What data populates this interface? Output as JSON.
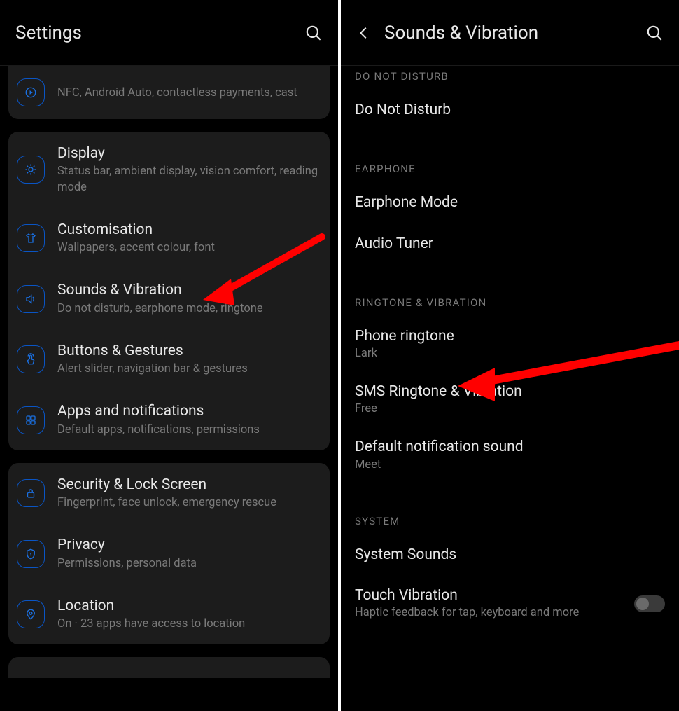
{
  "left": {
    "title": "Settings",
    "partial_top": {
      "title": "",
      "sub": "NFC, Android Auto, contactless payments, cast"
    },
    "group1": [
      {
        "icon": "brightness",
        "title": "Display",
        "sub": "Status bar, ambient display, vision comfort, reading mode"
      },
      {
        "icon": "shirt",
        "title": "Customisation",
        "sub": "Wallpapers, accent colour, font"
      },
      {
        "icon": "volume",
        "title": "Sounds & Vibration",
        "sub": "Do not disturb, earphone mode, ringtone"
      },
      {
        "icon": "touch",
        "title": "Buttons & Gestures",
        "sub": "Alert slider, navigation bar & gestures"
      },
      {
        "icon": "apps",
        "title": "Apps and notifications",
        "sub": "Default apps, notifications, permissions"
      }
    ],
    "group2": [
      {
        "icon": "lock",
        "title": "Security & Lock Screen",
        "sub": "Fingerprint, face unlock, emergency rescue"
      },
      {
        "icon": "shield",
        "title": "Privacy",
        "sub": "Permissions, personal data"
      },
      {
        "icon": "pin",
        "title": "Location",
        "sub": "On · 23 apps have access to location"
      }
    ]
  },
  "right": {
    "title": "Sounds & Vibration",
    "sections": {
      "dnd": {
        "header": "DO NOT DISTURB",
        "items": [
          {
            "title": "Do Not Disturb"
          }
        ]
      },
      "earphone": {
        "header": "EARPHONE",
        "items": [
          {
            "title": "Earphone Mode"
          },
          {
            "title": "Audio Tuner"
          }
        ]
      },
      "ringtone": {
        "header": "RINGTONE & VIBRATION",
        "items": [
          {
            "title": "Phone ringtone",
            "sub": "Lark"
          },
          {
            "title": "SMS Ringtone & Vibration",
            "sub": "Free"
          },
          {
            "title": "Default notification sound",
            "sub": "Meet"
          }
        ]
      },
      "system": {
        "header": "SYSTEM",
        "items": [
          {
            "title": "System Sounds"
          },
          {
            "title": "Touch Vibration",
            "sub": "Haptic feedback for tap, keyboard and more",
            "toggle": false
          }
        ]
      }
    }
  }
}
